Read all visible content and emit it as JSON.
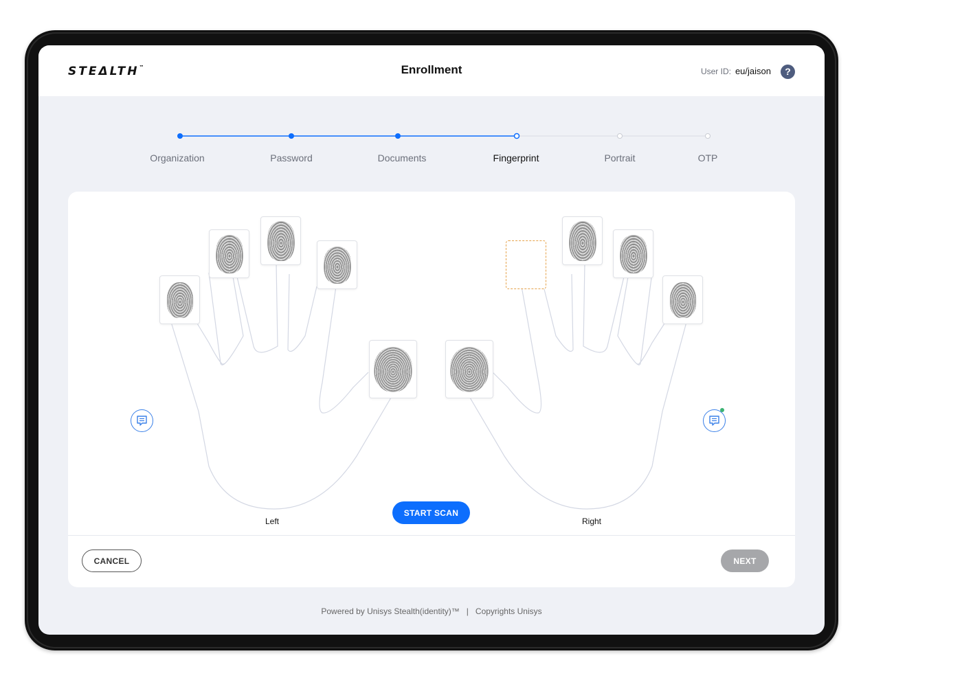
{
  "header": {
    "logo": "STEΔLTH",
    "logo_tm": "™",
    "title": "Enrollment",
    "user_id_label": "User ID:",
    "user_id_value": "eu/jaison",
    "help_glyph": "?"
  },
  "stepper": {
    "steps": [
      {
        "label": "Organization",
        "state": "complete"
      },
      {
        "label": "Password",
        "state": "complete"
      },
      {
        "label": "Documents",
        "state": "complete"
      },
      {
        "label": "Fingerprint",
        "state": "current"
      },
      {
        "label": "Portrait",
        "state": "pending"
      },
      {
        "label": "OTP",
        "state": "pending"
      }
    ],
    "colors": {
      "complete": "#0d6efd",
      "pending": "#c9ccd3"
    }
  },
  "hands": {
    "left_label": "Left",
    "right_label": "Right",
    "left_fingers": [
      {
        "finger": "little",
        "captured": true
      },
      {
        "finger": "ring",
        "captured": true
      },
      {
        "finger": "middle",
        "captured": true
      },
      {
        "finger": "index",
        "captured": true
      },
      {
        "finger": "thumb",
        "captured": true
      }
    ],
    "right_fingers": [
      {
        "finger": "thumb",
        "captured": true
      },
      {
        "finger": "index",
        "captured": false
      },
      {
        "finger": "middle",
        "captured": true
      },
      {
        "finger": "ring",
        "captured": true
      },
      {
        "finger": "little",
        "captured": true
      }
    ],
    "left_note_icon": "comment-icon",
    "right_note_icon": "comment-icon",
    "right_note_has_indicator": true
  },
  "actions": {
    "start_scan": "START SCAN",
    "cancel": "CANCEL",
    "next": "NEXT"
  },
  "footer": {
    "powered_by": "Powered by Unisys Stealth(identity)™",
    "separator": "|",
    "copyright": "Copyrights Unisys"
  }
}
